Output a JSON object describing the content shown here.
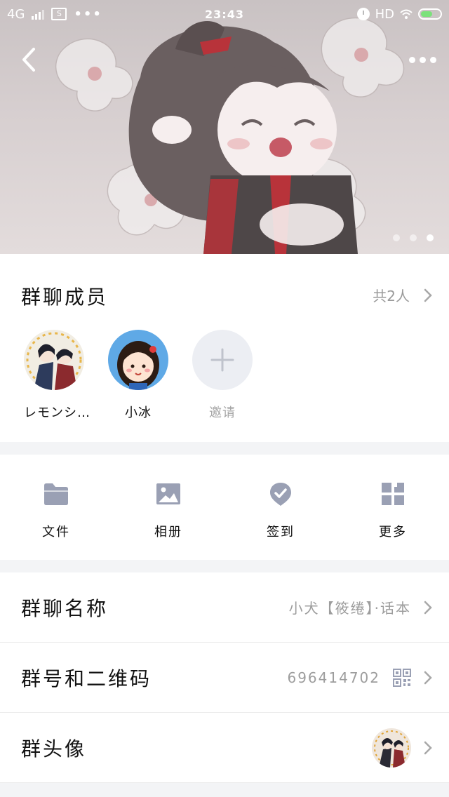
{
  "status_bar": {
    "network": "4G",
    "time": "23:43",
    "hd": "HD",
    "dots": "•••",
    "sim_glyph": "S"
  },
  "header": {
    "back_icon": "chevron-left-icon",
    "more_icon": "more-dots-icon",
    "pager_count": 3,
    "pager_active": 2
  },
  "members": {
    "title": "群聊成员",
    "count_text": "共2人",
    "list": [
      {
        "name": "レモンシ…",
        "avatar": "anime-pair-avatar"
      },
      {
        "name": "小冰",
        "avatar": "cartoon-girl-avatar"
      }
    ],
    "invite_label": "邀请"
  },
  "tools": [
    {
      "label": "文件",
      "icon": "folder-icon"
    },
    {
      "label": "相册",
      "icon": "image-icon"
    },
    {
      "label": "签到",
      "icon": "check-badge-icon"
    },
    {
      "label": "更多",
      "icon": "grid-icon"
    }
  ],
  "settings": {
    "group_name_label": "群聊名称",
    "group_name_value": "小犬【筱绻】·话本",
    "group_id_label": "群号和二维码",
    "group_id_value": "696414702",
    "group_avatar_label": "群头像"
  },
  "colors": {
    "icon_gray": "#9aa0b4",
    "accent_red": "#b8333a",
    "divider": "#f3f4f6"
  }
}
